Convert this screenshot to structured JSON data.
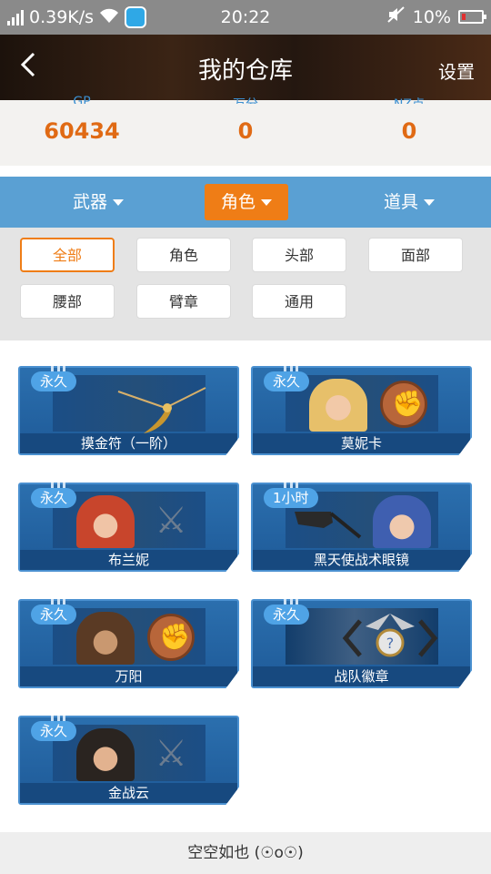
{
  "status_bar": {
    "speed": "0.39K/s",
    "time": "20:22",
    "battery": "10%"
  },
  "header": {
    "back_icon": "back-chevron-icon",
    "title": "我的仓库",
    "settings_label": "设置"
  },
  "stats": {
    "items": [
      {
        "label": "GP",
        "value": "60434"
      },
      {
        "label": "万分",
        "value": "0"
      },
      {
        "label": "NZ点",
        "value": "0"
      }
    ]
  },
  "categories": {
    "items": [
      {
        "label": "武器",
        "active": false
      },
      {
        "label": "角色",
        "active": true
      },
      {
        "label": "道具",
        "active": false
      }
    ],
    "active_color": "#ef7d16",
    "bar_color": "#5aa0d3"
  },
  "filters": {
    "items": [
      {
        "label": "全部",
        "active": true
      },
      {
        "label": "角色",
        "active": false
      },
      {
        "label": "头部",
        "active": false
      },
      {
        "label": "面部",
        "active": false
      },
      {
        "label": "腰部",
        "active": false
      },
      {
        "label": "臂章",
        "active": false
      },
      {
        "label": "通用",
        "active": false
      }
    ]
  },
  "items": [
    {
      "tag": "永久",
      "name": "摸金符（一阶）",
      "icon": "golden-pendant-icon"
    },
    {
      "tag": "永久",
      "name": "莫妮卡",
      "icon": "character-portrait-icon"
    },
    {
      "tag": "永久",
      "name": "布兰妮",
      "icon": "character-portrait-icon"
    },
    {
      "tag": "1小时",
      "name": "黑天使战术眼镜",
      "icon": "tactical-glasses-icon"
    },
    {
      "tag": "永久",
      "name": "万阳",
      "icon": "character-portrait-icon"
    },
    {
      "tag": "永久",
      "name": "战队徽章",
      "icon": "team-badge-icon"
    },
    {
      "tag": "永久",
      "name": "金战云",
      "icon": "character-portrait-icon"
    }
  ],
  "footer": {
    "text": "空空如也 (☉o☉)"
  }
}
